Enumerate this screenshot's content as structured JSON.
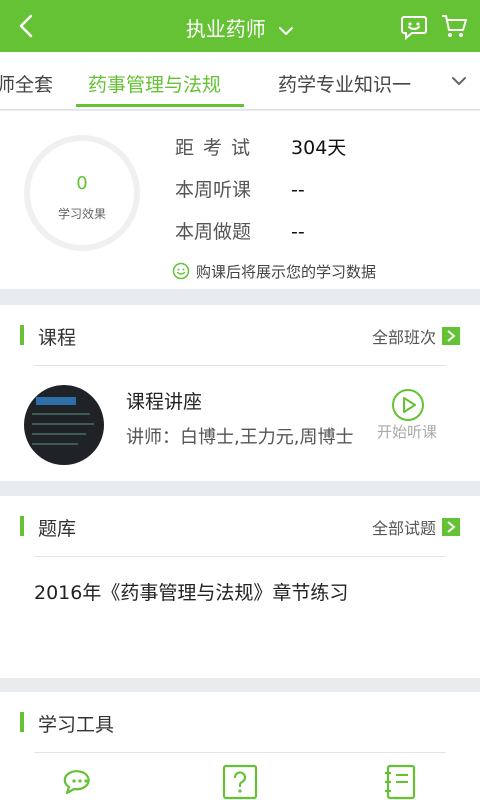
{
  "header": {
    "title": "执业药师",
    "icons": [
      "back-icon",
      "chevron-down-icon",
      "smile-icon",
      "cart-icon"
    ]
  },
  "tabs": {
    "items": [
      {
        "label": "师全套"
      },
      {
        "label": "药事管理与法规",
        "active": true
      },
      {
        "label": "药学专业知识一"
      }
    ]
  },
  "stats": {
    "ring_value": "0",
    "ring_label": "学习效果",
    "rows": [
      {
        "key": "距考试",
        "value": "304天"
      },
      {
        "key": "本周听课",
        "value": "--"
      },
      {
        "key": "本周做题",
        "value": "--"
      }
    ],
    "hint": "购课后将展示您的学习数据"
  },
  "course": {
    "section_title": "课程",
    "more_label": "全部班次",
    "item_title": "课程讲座",
    "teacher": "讲师：白博士,王力元,周博士",
    "action_label": "开始听课"
  },
  "bank": {
    "section_title": "题库",
    "more_label": "全部试题",
    "item": "2016年《药事管理与法规》章节练习"
  },
  "tools": {
    "section_title": "学习工具",
    "icons": [
      "chat-icon",
      "question-icon",
      "notebook-icon"
    ]
  },
  "colors": {
    "accent": "#64c234",
    "background": "#e9ecee"
  }
}
